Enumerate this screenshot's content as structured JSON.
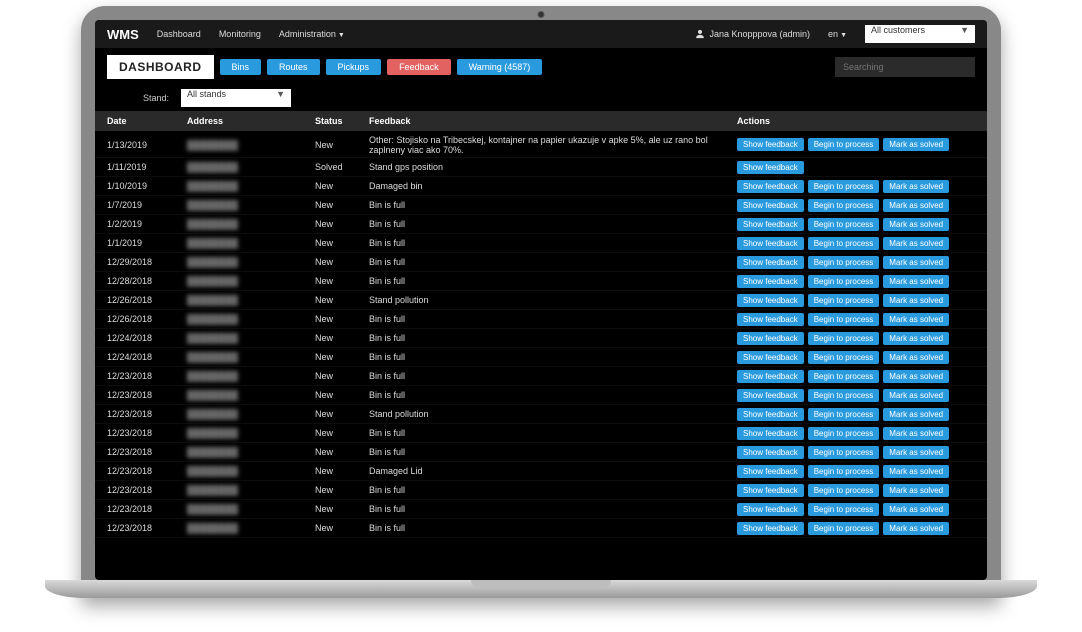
{
  "brand": "WMS",
  "nav": {
    "dashboard": "Dashboard",
    "monitoring": "Monitoring",
    "admin": "Administration"
  },
  "user": {
    "label": "Jana Knopppova (admin)"
  },
  "lang": "en",
  "customer_select": "All customers",
  "page_title": "DASHBOARD",
  "tabs": {
    "bins": "Bins",
    "routes": "Routes",
    "pickups": "Pickups",
    "feedback": "Feedback",
    "warning": "Warning (4587)"
  },
  "search_placeholder": "Searching",
  "filter": {
    "stand_label": "Stand:",
    "stand_value": "All stands"
  },
  "columns": {
    "date": "Date",
    "address": "Address",
    "status": "Status",
    "feedback": "Feedback",
    "actions": "Actions"
  },
  "action_labels": {
    "show": "Show feedback",
    "begin": "Begin to process",
    "mark": "Mark as solved"
  },
  "rows": [
    {
      "date": "1/13/2019",
      "status": "New",
      "feedback": "Other: Stojisko na Tribecskej, kontajner na papier ukazuje v apke 5%, ale uz rano bol zaplneny viac ako 70%.",
      "solved": false
    },
    {
      "date": "1/11/2019",
      "status": "Solved",
      "feedback": "Stand gps position",
      "solved": true
    },
    {
      "date": "1/10/2019",
      "status": "New",
      "feedback": "Damaged bin",
      "solved": false
    },
    {
      "date": "1/7/2019",
      "status": "New",
      "feedback": "Bin is full",
      "solved": false
    },
    {
      "date": "1/2/2019",
      "status": "New",
      "feedback": "Bin is full",
      "solved": false
    },
    {
      "date": "1/1/2019",
      "status": "New",
      "feedback": "Bin is full",
      "solved": false
    },
    {
      "date": "12/29/2018",
      "status": "New",
      "feedback": "Bin is full",
      "solved": false
    },
    {
      "date": "12/28/2018",
      "status": "New",
      "feedback": "Bin is full",
      "solved": false
    },
    {
      "date": "12/26/2018",
      "status": "New",
      "feedback": "Stand pollution",
      "solved": false
    },
    {
      "date": "12/26/2018",
      "status": "New",
      "feedback": "Bin is full",
      "solved": false
    },
    {
      "date": "12/24/2018",
      "status": "New",
      "feedback": "Bin is full",
      "solved": false
    },
    {
      "date": "12/24/2018",
      "status": "New",
      "feedback": "Bin is full",
      "solved": false
    },
    {
      "date": "12/23/2018",
      "status": "New",
      "feedback": "Bin is full",
      "solved": false
    },
    {
      "date": "12/23/2018",
      "status": "New",
      "feedback": "Bin is full",
      "solved": false
    },
    {
      "date": "12/23/2018",
      "status": "New",
      "feedback": "Stand pollution",
      "solved": false
    },
    {
      "date": "12/23/2018",
      "status": "New",
      "feedback": "Bin is full",
      "solved": false
    },
    {
      "date": "12/23/2018",
      "status": "New",
      "feedback": "Bin is full",
      "solved": false
    },
    {
      "date": "12/23/2018",
      "status": "New",
      "feedback": "Damaged Lid",
      "solved": false
    },
    {
      "date": "12/23/2018",
      "status": "New",
      "feedback": "Bin is full",
      "solved": false
    },
    {
      "date": "12/23/2018",
      "status": "New",
      "feedback": "Bin is full",
      "solved": false
    },
    {
      "date": "12/23/2018",
      "status": "New",
      "feedback": "Bin is full",
      "solved": false
    }
  ]
}
